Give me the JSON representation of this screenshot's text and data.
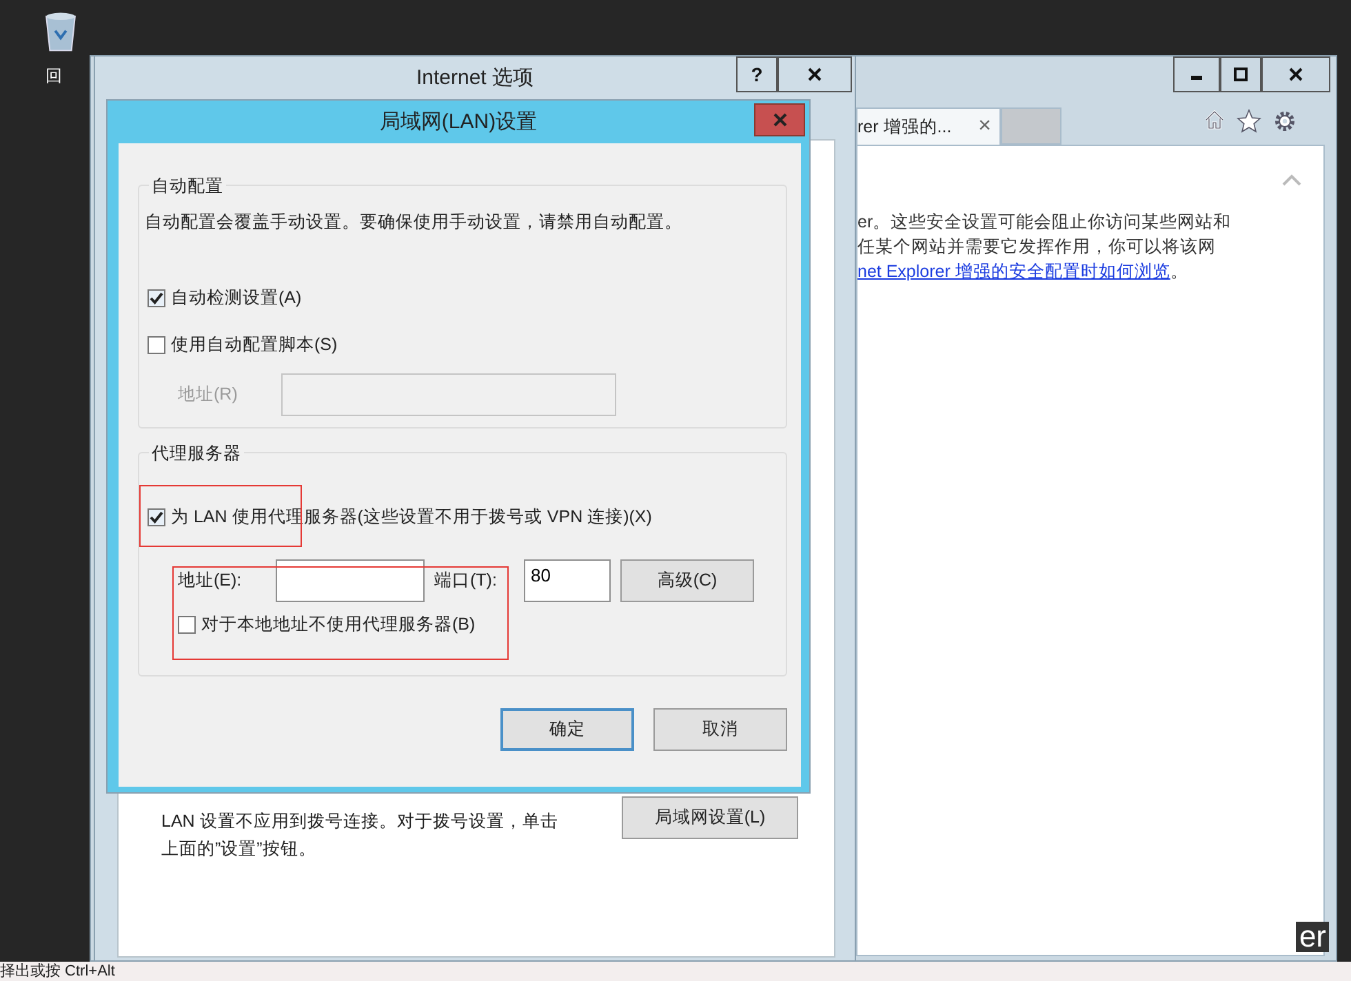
{
  "desktop": {
    "icons": [
      {
        "label": "回"
      }
    ]
  },
  "browser": {
    "tab": {
      "title": "rer 增强的...",
      "close": "×"
    },
    "content": {
      "lines": [
        "er。这些安全设置可能会阻止你访问某些网站和",
        "任某个网站并需要它发挥作用，你可以将该网"
      ],
      "link": "net Explorer 增强的安全配置时如何浏览",
      "link_end": "。"
    },
    "corner_text": "er"
  },
  "internet_options": {
    "title": "Internet 选项",
    "help": "?",
    "lan_note": "LAN 设置不应用到拨号连接。对于拨号设置，单击上面的”设置”按钮。",
    "lan_button": "局域网设置(L)"
  },
  "lan_dialog": {
    "title": "局域网(LAN)设置",
    "auto_group": {
      "legend": "自动配置",
      "description": "自动配置会覆盖手动设置。要确保使用手动设置，请禁用自动配置。",
      "options": [
        {
          "label": "自动检测设置(A)",
          "checked": true
        },
        {
          "label": "使用自动配置脚本(S)",
          "checked": false
        }
      ],
      "address": {
        "label": "地址(R)",
        "disabled": true
      }
    },
    "proxy_group": {
      "legend": "代理服务器",
      "use_proxy": {
        "label": "为 LAN 使用代理服务器(这些设置不用于拨号或 VPN 连接)(X)",
        "checked": true
      },
      "address": {
        "label": "地址(E):"
      },
      "port": {
        "label": "端口(T):",
        "value": "80"
      },
      "advanced": "高级(C)",
      "bypass": {
        "label": "对于本地地址不使用代理服务器(B)",
        "checked": false
      }
    },
    "buttons": [
      {
        "label": "确定",
        "default": true
      },
      {
        "label": "取消",
        "default": false
      }
    ]
  },
  "status_bar": {
    "text": "择出或按 Ctrl+Alt"
  }
}
